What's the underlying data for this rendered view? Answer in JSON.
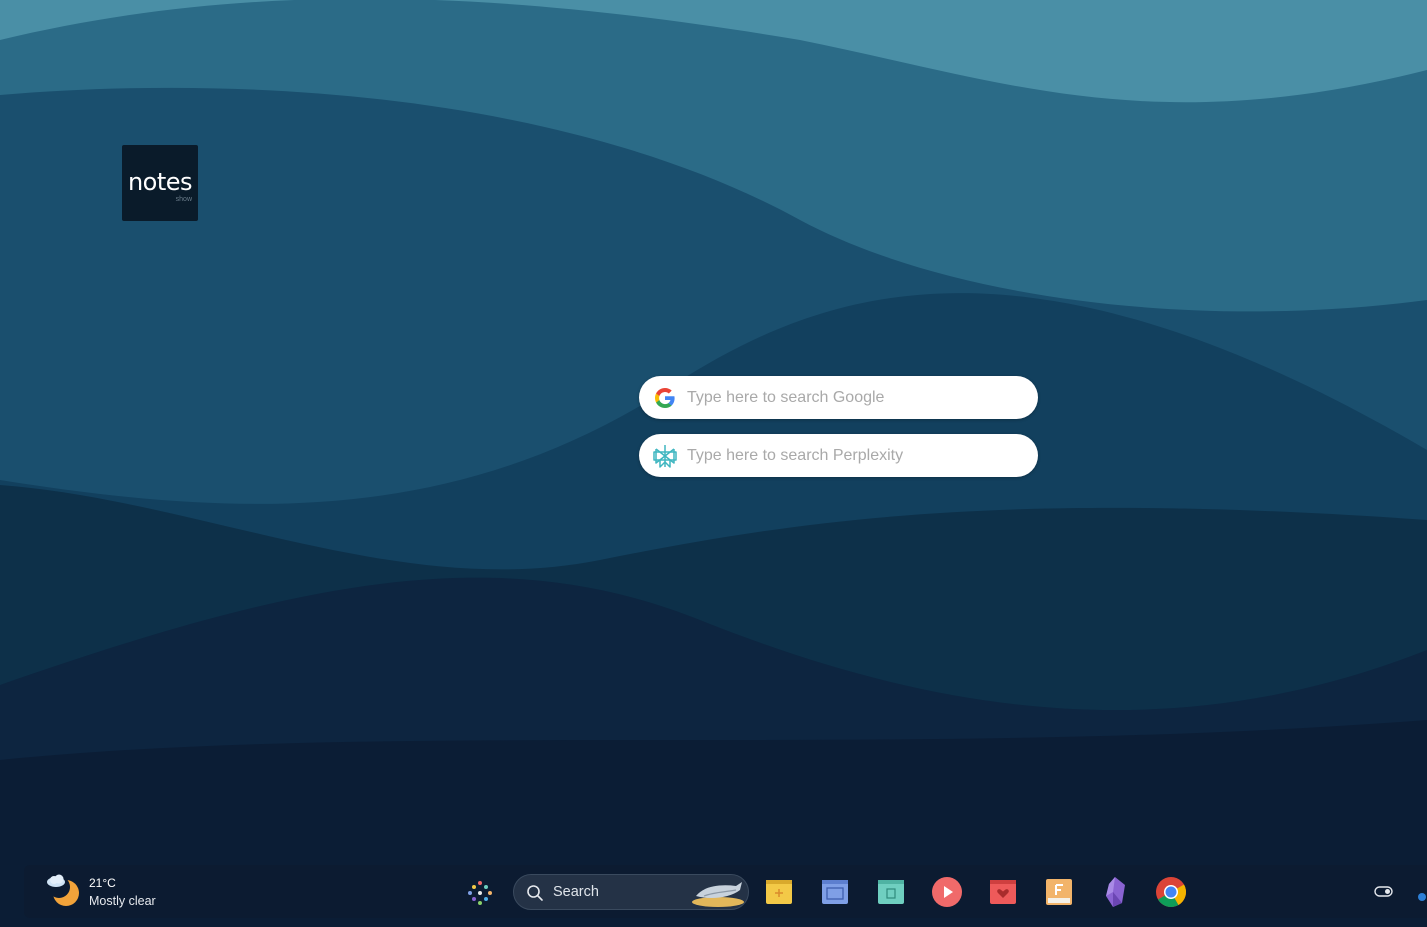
{
  "desktop": {
    "shortcut": {
      "title": "notes",
      "subtitle": "show"
    }
  },
  "widgets": {
    "google": {
      "placeholder": "Type here to search Google"
    },
    "perplexity": {
      "placeholder": "Type here to search Perplexity"
    }
  },
  "taskbar": {
    "weather": {
      "temperature": "21°C",
      "condition": "Mostly clear",
      "icon": "partly-cloudy-night-icon"
    },
    "search": {
      "label": "Search"
    },
    "apps": [
      {
        "icon": "sticky-notes-icon",
        "color": "#f3c947"
      },
      {
        "icon": "window-app-icon",
        "color": "#7f9fe6"
      },
      {
        "icon": "calendar-app-icon",
        "color": "#6fcfc0"
      },
      {
        "icon": "media-player-icon",
        "color": "#f06a6a"
      },
      {
        "icon": "favorites-app-icon",
        "color": "#ee5a5a"
      },
      {
        "icon": "notes-f-app-icon",
        "color": "#f2b46a"
      },
      {
        "icon": "obsidian-icon",
        "color": "#8a63d2"
      },
      {
        "icon": "chrome-icon",
        "color": "#4285f4"
      }
    ]
  },
  "colors": {
    "accent": "#2d7fd6",
    "taskbar": "#0c1b31"
  }
}
